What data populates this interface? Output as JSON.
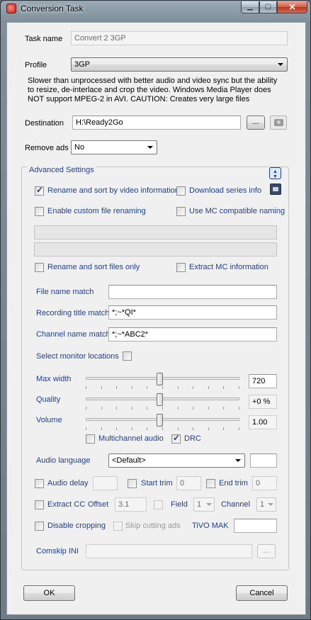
{
  "window": {
    "title": "Conversion Task",
    "minimize_icon": "minimize-icon",
    "maximize_icon": "maximize-icon",
    "close_icon": "close-icon",
    "min_glyph": "▁",
    "max_glyph": "▢",
    "close_glyph": "✕"
  },
  "task": {
    "name_label": "Task name",
    "name_value": "Convert 2 3GP",
    "profile_label": "Profile",
    "profile_value": "3GP",
    "description": "Slower than unprocessed with better audio and video sync but the ability to resize, de-interlace and crop the video. Windows Media Player does NOT support MPEG-2 in AVI. CAUTION: Creates very large files",
    "destination_label": "Destination",
    "destination_value": "H:\\Ready2Go",
    "browse_label": "...",
    "remove_ads_label": "Remove ads",
    "remove_ads_value": "No"
  },
  "advanced": {
    "title": "Advanced Settings",
    "collapse_glyph": "▲▼",
    "rename_sort_video": "Rename and sort by video information",
    "download_series_info": "Download series info",
    "enable_custom_renaming": "Enable custom file renaming",
    "use_mc_naming": "Use MC compatible naming",
    "rename_sort_files_only": "Rename and sort files only",
    "extract_mc_info": "Extract MC information",
    "file_name_match_label": "File name match",
    "file_name_match_value": "",
    "recording_title_match_label": "Recording title match",
    "recording_title_match_value": "*;~*QI*",
    "channel_name_match_label": "Channel name match",
    "channel_name_match_value": "*;~*ABC2*",
    "select_monitor_label": "Select monitor locations",
    "max_width_label": "Max width",
    "max_width_value": "720",
    "max_width_level": 0.5,
    "quality_label": "Quality",
    "quality_value": "+0 %",
    "quality_level": 0.5,
    "volume_label": "Volume",
    "volume_value": "1.00",
    "volume_level": 0.5,
    "multichannel_audio": "Multichannel audio",
    "drc": "DRC",
    "audio_language_label": "Audio language",
    "audio_language_value": "<Default>",
    "audio_delay_label": "Audio delay",
    "start_trim_label": "Start trim",
    "start_trim_value": "0",
    "end_trim_label": "End trim",
    "end_trim_value": "0",
    "extract_cc_label": "Extract CC",
    "offset_label": "Offset",
    "offset_value": "3.1",
    "field_label": "Field",
    "field_value": "1",
    "channel_label": "Channel",
    "channel_value": "1",
    "disable_cropping_label": "Disable cropping",
    "skip_cutting_ads_label": "Skip cutting ads",
    "tivo_mak_label": "TiVO MAK",
    "comskip_ini_label": "Comskip INI",
    "comskip_browse_label": "..."
  },
  "footer": {
    "ok_label": "OK",
    "cancel_label": "Cancel"
  },
  "colors": {
    "accent_label": "#1f3f8f",
    "window_frame": "#7f8f99",
    "client_bg": "#f0f0f0",
    "close_red": "#cf5e44"
  }
}
